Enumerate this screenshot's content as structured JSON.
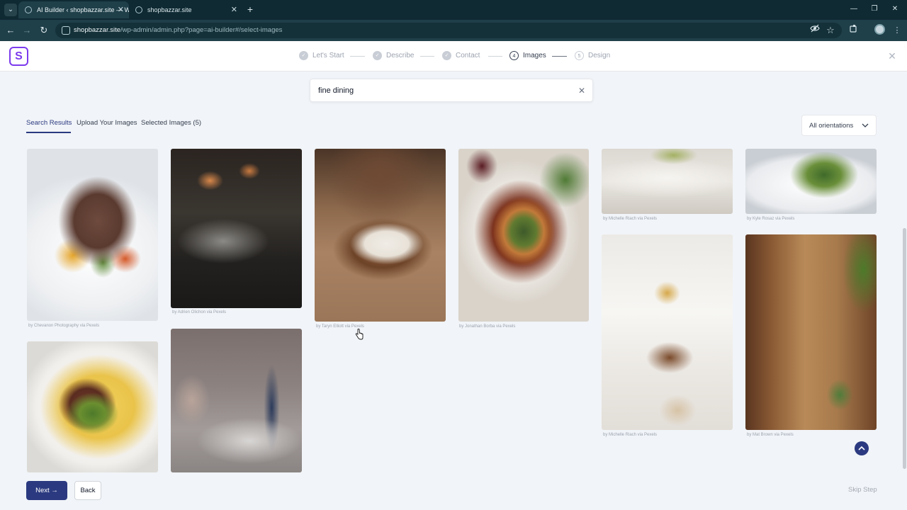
{
  "browser": {
    "tabs": [
      {
        "title": "AI Builder ‹ shopbazzar.site — W"
      },
      {
        "title": "shopbazzar.site"
      }
    ],
    "url_host": "shopbazzar.site",
    "url_path": "/wp-admin/admin.php?page=ai-builder#/select-images"
  },
  "header": {
    "logo_letter": "S",
    "steps": [
      {
        "label": "Let's Start",
        "state": "done"
      },
      {
        "label": "Describe",
        "state": "done"
      },
      {
        "label": "Contact",
        "state": "done"
      },
      {
        "label": "Images",
        "number": "4",
        "state": "current"
      },
      {
        "label": "Design",
        "number": "5",
        "state": "upcoming"
      }
    ]
  },
  "search": {
    "value": "fine dining"
  },
  "gallery_tabs": [
    {
      "label": "Search Results",
      "active": true
    },
    {
      "label": "Upload Your Images"
    },
    {
      "label": "Selected Images (5)"
    }
  ],
  "orientation": {
    "selected": "All orientations"
  },
  "images": [
    {
      "credit": "by Chevanon Photography via Pexels"
    },
    {
      "credit": "by Adrien Olichon via Pexels"
    },
    {
      "credit": "by Taryn Elliott via Pexels"
    },
    {
      "credit": "by Jonathan Borba via Pexels"
    },
    {
      "credit": "by Michelle Riach via Pexels"
    },
    {
      "credit": "by Kyle Rosaz via Pexels"
    },
    {
      "credit": ""
    },
    {
      "credit": ""
    },
    {
      "credit": "by Michelle Riach via Pexels"
    },
    {
      "credit": "by Mat Brown via Pexels"
    }
  ],
  "footer": {
    "next_label": "Next",
    "back_label": "Back",
    "skip_label": "Skip Step"
  },
  "colors": {
    "primary": "#2b3a80",
    "logo": "#7c3aed"
  }
}
